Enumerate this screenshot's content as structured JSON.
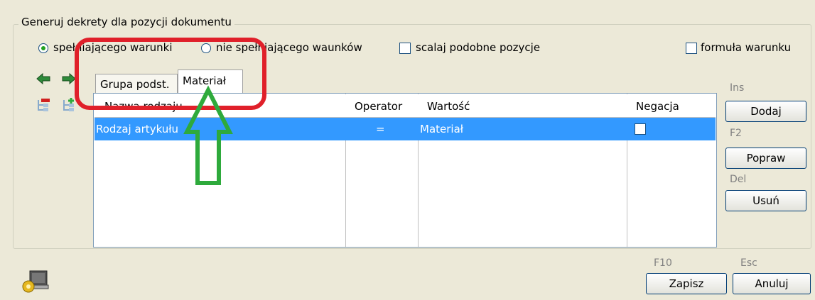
{
  "group_title": "Generuj dekrety dla pozycji dokumentu",
  "options": {
    "radio_meeting": "spełniającego warunki",
    "radio_not_meeting": "nie spełniającego waunków",
    "merge_similar": "scalaj podobne pozycje",
    "condition_formula": "formuła warunku"
  },
  "tabs": [
    {
      "label": "Grupa podst."
    },
    {
      "label": "Materiał"
    }
  ],
  "table": {
    "columns": [
      "Nazwa rodzaju",
      "Operator",
      "Wartość",
      "Negacja"
    ],
    "rows": [
      {
        "name": "Rodzaj artykułu",
        "operator": "=",
        "value": "Materiał"
      }
    ]
  },
  "side_buttons": {
    "add_hint": "Ins",
    "add": "Dodaj",
    "edit_hint": "F2",
    "edit": "Popraw",
    "delete_hint": "Del",
    "delete": "Usuń"
  },
  "footer": {
    "save_hint": "F10",
    "save": "Zapisz",
    "cancel_hint": "Esc",
    "cancel": "Anuluj"
  },
  "colors": {
    "annotation_red": "#e0202a",
    "annotation_green": "#2eaa3c",
    "selection_blue": "#3399ff"
  }
}
